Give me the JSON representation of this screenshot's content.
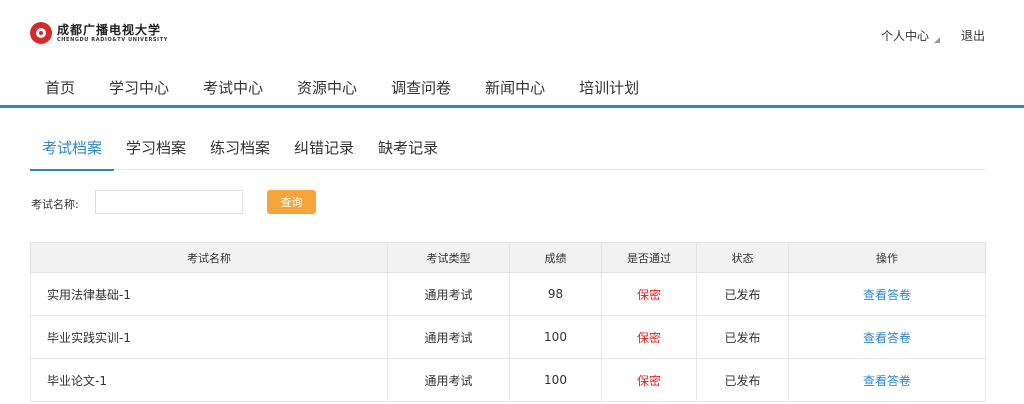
{
  "header": {
    "logo_cn": "成都广播电视大学",
    "logo_en": "CHENGDU RADIO&TV UNIVERSITY",
    "user_center": "个人中心",
    "logout": "退出"
  },
  "nav": {
    "items": [
      {
        "label": "首页"
      },
      {
        "label": "学习中心"
      },
      {
        "label": "考试中心"
      },
      {
        "label": "资源中心"
      },
      {
        "label": "调查问卷"
      },
      {
        "label": "新闻中心"
      },
      {
        "label": "培训计划"
      }
    ]
  },
  "tabs": {
    "items": [
      {
        "label": "考试档案"
      },
      {
        "label": "学习档案"
      },
      {
        "label": "练习档案"
      },
      {
        "label": "纠错记录"
      },
      {
        "label": "缺考记录"
      }
    ],
    "active_index": 0
  },
  "search": {
    "label": "考试名称:",
    "value": "",
    "placeholder": "",
    "button": "查询"
  },
  "table": {
    "headers": [
      "考试名称",
      "考试类型",
      "成绩",
      "是否通过",
      "状态",
      "操作"
    ],
    "rows": [
      {
        "name": "实用法律基础-1",
        "type": "通用考试",
        "score": "98",
        "pass": "保密",
        "status": "已发布",
        "action": "查看答卷"
      },
      {
        "name": "毕业实践实训-1",
        "type": "通用考试",
        "score": "100",
        "pass": "保密",
        "status": "已发布",
        "action": "查看答卷"
      },
      {
        "name": "毕业论文-1",
        "type": "通用考试",
        "score": "100",
        "pass": "保密",
        "status": "已发布",
        "action": "查看答卷"
      }
    ]
  },
  "colors": {
    "accent": "#2e86c9",
    "button": "#f6a53c",
    "pass_text": "#e02020",
    "logo": "#d42a2a"
  },
  "icons": {
    "logo": "university-logo-icon",
    "user_caret": "caret-down-icon"
  }
}
